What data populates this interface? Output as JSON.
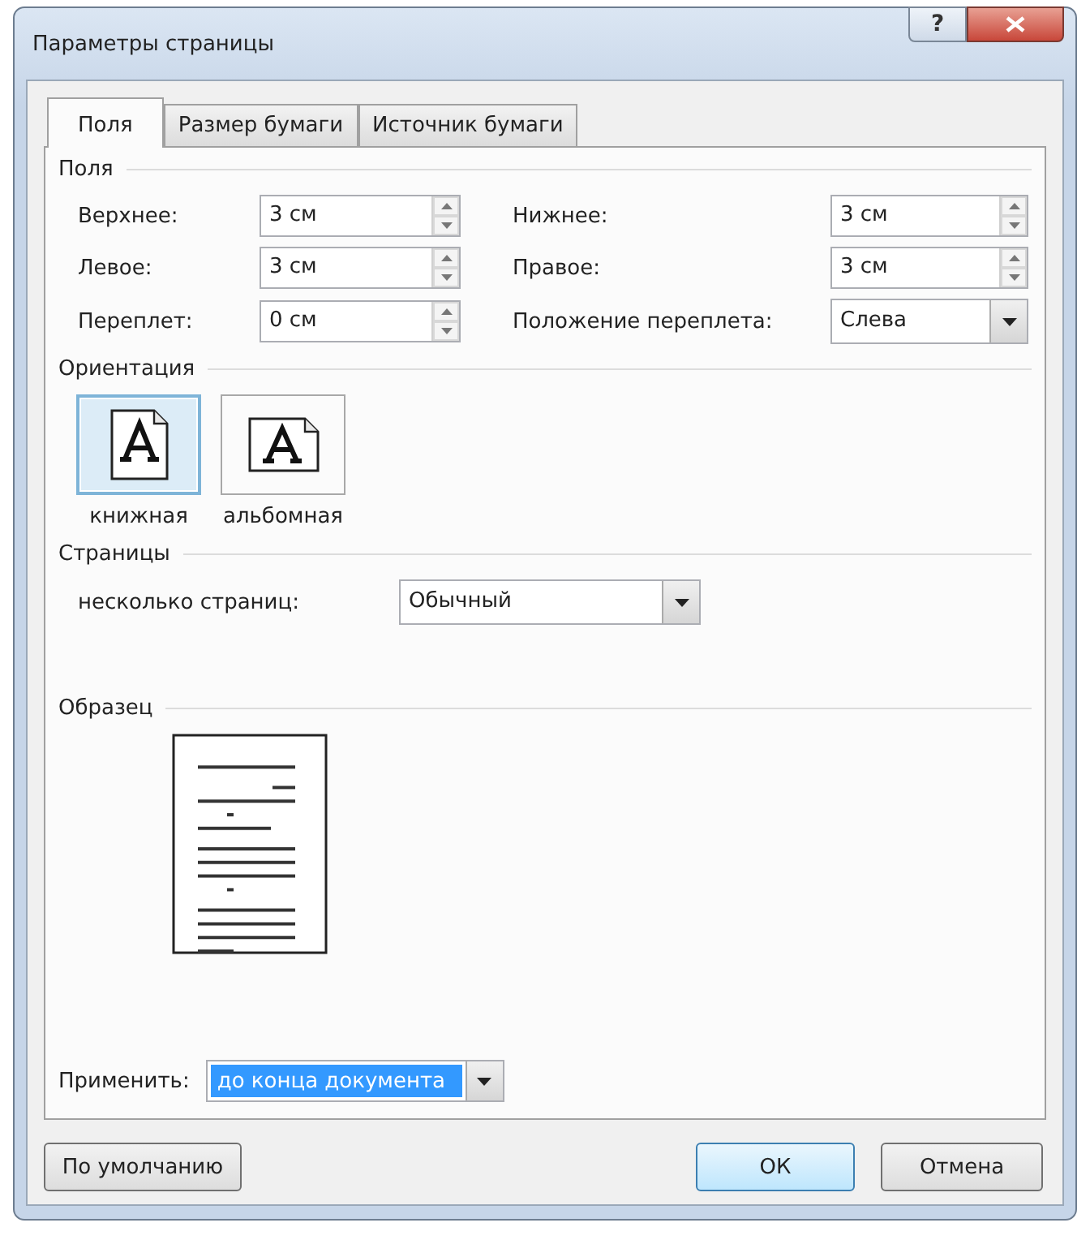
{
  "window": {
    "title": "Параметры страницы",
    "help": "?"
  },
  "tabs": [
    {
      "label": "Поля",
      "selected": true
    },
    {
      "label": "Размер бумаги",
      "selected": false
    },
    {
      "label": "Источник бумаги",
      "selected": false
    }
  ],
  "margins": {
    "heading": "Поля",
    "fields": [
      {
        "label": "Верхнее:",
        "value": "3 см",
        "kind": "spin"
      },
      {
        "label": "Нижнее:",
        "value": "3 см",
        "kind": "spin"
      },
      {
        "label": "Левое:",
        "value": "3 см",
        "kind": "spin"
      },
      {
        "label": "Правое:",
        "value": "3 см",
        "kind": "spin"
      },
      {
        "label": "Переплет:",
        "value": "0 см",
        "kind": "spin"
      },
      {
        "label": "Положение переплета:",
        "value": "Слева",
        "kind": "dropdown"
      }
    ]
  },
  "orientation": {
    "heading": "Ориентация",
    "options": [
      {
        "label": "книжная",
        "selected": true,
        "kind": "portrait"
      },
      {
        "label": "альбомная",
        "selected": false,
        "kind": "landscape"
      }
    ]
  },
  "pages": {
    "heading": "Страницы",
    "label": "несколько страниц:",
    "value": "Обычный"
  },
  "preview": {
    "heading": "Образец"
  },
  "apply": {
    "label": "Применить:",
    "value": "до конца документа",
    "selected": true
  },
  "buttons": [
    {
      "label": "По умолчанию",
      "kind": "default"
    },
    {
      "label": "ОК",
      "kind": "ok"
    },
    {
      "label": "Отмена",
      "kind": "cancel"
    }
  ]
}
